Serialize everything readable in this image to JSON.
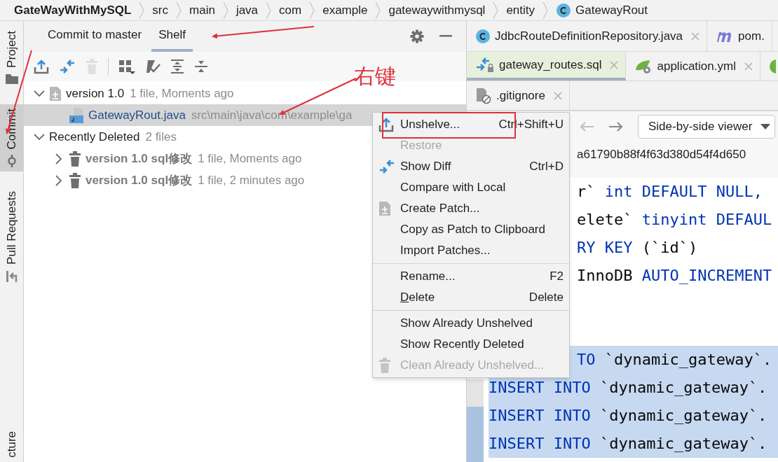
{
  "breadcrumb": {
    "project": "GateWayWithMySQL",
    "segments": [
      "src",
      "main",
      "java",
      "com",
      "example",
      "gatewaywithmysql",
      "entity"
    ],
    "class_name": "GatewayRout"
  },
  "tool_stripe": [
    {
      "label": "Project",
      "selected": false
    },
    {
      "label": "Commit",
      "selected": true
    },
    {
      "label": "Pull Requests",
      "selected": false
    },
    {
      "label": "cture",
      "selected": false
    }
  ],
  "commit_panel": {
    "tabs": [
      {
        "label": "Commit to master",
        "selected": false
      },
      {
        "label": "Shelf",
        "selected": true
      }
    ],
    "toolbar": [
      {
        "kind": "button",
        "disabled": false
      },
      {
        "kind": "button",
        "disabled": false
      },
      {
        "kind": "button",
        "disabled": true
      },
      {
        "kind": "separator"
      },
      {
        "kind": "button",
        "disabled": false
      },
      {
        "kind": "button",
        "disabled": false
      },
      {
        "kind": "button",
        "disabled": false
      },
      {
        "kind": "button",
        "disabled": false
      }
    ],
    "tree": [
      {
        "kind": "shelf",
        "name": "version 1.0",
        "detail": "1 file, Moments ago",
        "expanded": true,
        "children": [
          {
            "kind": "file",
            "name": "GatewayRout.java",
            "detail": "src\\main\\java\\com\\example\\ga",
            "selected": true
          }
        ]
      },
      {
        "kind": "group",
        "name": "Recently Deleted",
        "detail": "2 files",
        "expanded": true,
        "children": [
          {
            "kind": "deleted",
            "name": "version 1.0 sql修改",
            "detail": "1 file, Moments ago",
            "expanded": false,
            "selected": false
          },
          {
            "kind": "deleted",
            "name": "version 1.0 sql修改",
            "detail": "1 file, 2 minutes ago",
            "expanded": false,
            "selected": false
          }
        ]
      }
    ]
  },
  "editor": {
    "tab_rows": [
      [
        {
          "label": "JdbcRouteDefinitionRepository.java",
          "selected": false,
          "closable": true
        },
        {
          "label": "pom.",
          "selected": false,
          "closable": false
        }
      ],
      [
        {
          "label": "gateway_routes.sql",
          "selected": true,
          "closable": true
        },
        {
          "label": "application.yml",
          "selected": false,
          "closable": true
        },
        {
          "selected": false
        }
      ],
      [
        {
          "label": ".gitignore",
          "selected": false,
          "closable": true
        }
      ]
    ],
    "viewer": "Side-by-side viewer",
    "hash": "a61790b88f4f63d380d54f4d650",
    "lines": [
      {
        "kind": "code",
        "covered": true,
        "selected": false,
        "tokens": [
          {
            "t": "r` ",
            "kind": "plain"
          },
          {
            "t": "int DEFAULT NULL,",
            "kind": "keyword"
          }
        ]
      },
      {
        "kind": "code",
        "covered": true,
        "selected": false,
        "tokens": [
          {
            "t": "elete` ",
            "kind": "plain"
          },
          {
            "t": "tinyint DEFAUL",
            "kind": "keyword"
          }
        ]
      },
      {
        "kind": "code",
        "covered": true,
        "selected": false,
        "tokens": [
          {
            "t": "RY KEY ",
            "kind": "keyword"
          },
          {
            "t": "(`id`)",
            "kind": "plain"
          }
        ]
      },
      {
        "kind": "code",
        "covered": true,
        "selected": false,
        "tokens": [
          {
            "t": "InnoDB ",
            "kind": "plain"
          },
          {
            "t": "AUTO_INCREMENT",
            "kind": "keyword"
          }
        ]
      },
      {
        "kind": "blank"
      },
      {
        "kind": "blank"
      },
      {
        "kind": "code",
        "covered": true,
        "selected": true,
        "tokens": [
          {
            "t": "TO ",
            "kind": "keyword"
          },
          {
            "t": "`dynamic_gateway`.",
            "kind": "plain"
          }
        ]
      },
      {
        "kind": "code",
        "covered": false,
        "selected": true,
        "tokens": [
          {
            "t": "INSERT INTO ",
            "kind": "keyword"
          },
          {
            "t": "`dynamic_gateway`.",
            "kind": "plain"
          }
        ]
      },
      {
        "kind": "code",
        "covered": false,
        "selected": true,
        "tokens": [
          {
            "t": "INSERT INTO ",
            "kind": "keyword"
          },
          {
            "t": "`dynamic_gateway`.",
            "kind": "plain"
          }
        ]
      },
      {
        "kind": "code",
        "covered": false,
        "selected": true,
        "tokens": [
          {
            "t": "INSERT INTO ",
            "kind": "keyword"
          },
          {
            "t": "`dynamic_gateway`.",
            "kind": "plain"
          }
        ]
      }
    ]
  },
  "context_menu": [
    {
      "kind": "item",
      "label": "Unshelve...",
      "shortcut": "Ctrl+Shift+U",
      "disabled": false
    },
    {
      "kind": "item",
      "label": "Restore",
      "disabled": true
    },
    {
      "kind": "item",
      "label": "Show Diff",
      "shortcut": "Ctrl+D",
      "disabled": false
    },
    {
      "kind": "item",
      "label": "Compare with Local",
      "disabled": false
    },
    {
      "kind": "item",
      "label": "Create Patch...",
      "disabled": false
    },
    {
      "kind": "item",
      "label": "Copy as Patch to Clipboard",
      "disabled": false
    },
    {
      "kind": "item",
      "label": "Import Patches...",
      "disabled": false
    },
    {
      "kind": "separator"
    },
    {
      "kind": "item",
      "label": "Rename...",
      "shortcut": "F2",
      "disabled": false
    },
    {
      "kind": "item",
      "label": "Delete",
      "shortcut": "Delete",
      "disabled": false
    },
    {
      "kind": "separator"
    },
    {
      "kind": "item",
      "label": "Show Already Unshelved",
      "disabled": false
    },
    {
      "kind": "item",
      "label": "Show Recently Deleted",
      "disabled": false
    },
    {
      "kind": "item",
      "label": "Clean Already Unshelved...",
      "disabled": true
    }
  ],
  "annotation": {
    "label": "右键"
  }
}
